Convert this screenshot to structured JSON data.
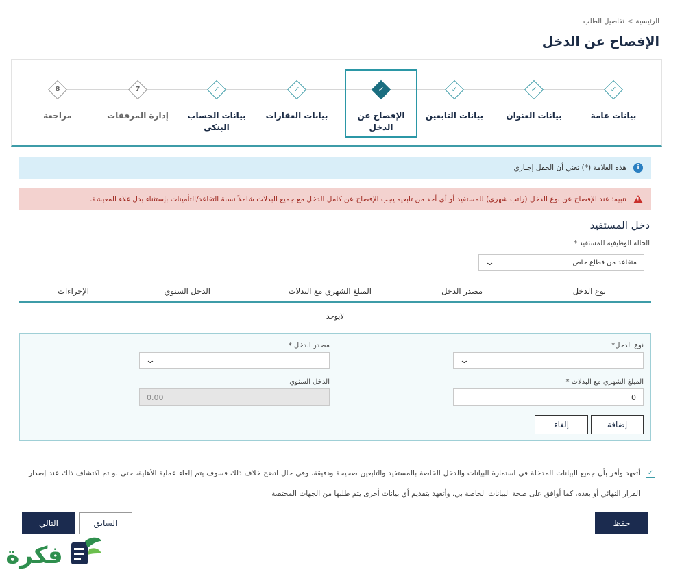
{
  "breadcrumb": {
    "home": "الرئيسية",
    "separator": ">",
    "current": "تفاصيل الطلب"
  },
  "page_title": "الإفصاح عن الدخل",
  "steps": [
    {
      "label": "بيانات عامة",
      "status": "done"
    },
    {
      "label": "بيانات العنوان",
      "status": "done"
    },
    {
      "label": "بيانات التابعين",
      "status": "done"
    },
    {
      "label": "الإفصاح عن الدخل",
      "status": "active"
    },
    {
      "label": "بيانات العقارات",
      "status": "done"
    },
    {
      "label": "بيانات الحساب البنكي",
      "status": "done"
    },
    {
      "label": "إدارة المرفقات",
      "status": "pending",
      "number": "7"
    },
    {
      "label": "مراجعة",
      "status": "pending",
      "number": "8"
    }
  ],
  "alerts": {
    "info": "هذه العلامة (*) تعني أن الحقل إجباري",
    "warning": "تنبيه: عند الإفصاح عن نوع الدخل (راتب شهري) للمستفيد أو أي أحد من تابعيه يجب الإفصاح عن كامل الدخل مع جميع البدلات شاملاً نسبة التقاعد/التأمينات بإستثناء بدل غلاء المعيشة."
  },
  "beneficiary_income": {
    "section_title": "دخل المستفيد",
    "employment_status_label": "الحالة الوظيفية للمستفيد *",
    "employment_status_value": "متقاعد من قطاع خاص"
  },
  "table": {
    "headers": [
      "نوع الدخل",
      "مصدر الدخل",
      "المبلغ الشهري مع البدلات",
      "الدخل السنوي",
      "الإجراءات"
    ],
    "empty_text": "لايوجد"
  },
  "form": {
    "income_type_label": "نوع الدخل*",
    "income_type_value": "",
    "income_source_label": "مصدر الدخل *",
    "income_source_value": "",
    "monthly_amount_label": "المبلغ الشهري مع البدلات *",
    "monthly_amount_value": "0",
    "annual_income_label": "الدخل السنوي",
    "annual_income_value": "0.00",
    "add_button": "إضافة",
    "cancel_button": "إلغاء"
  },
  "consent": {
    "checked": true,
    "text": "أتعهد وأقر بأن جميع البيانات المدخلة في استمارة البيانات والدخل الخاصة بالمستفيد والتابعين صحيحة ودقيقة، وفي حال اتضح خلاف ذلك فسوف يتم إلغاء عملية الأهلية، حتى لو تم اكتشاف ذلك عند إصدار القرار النهائي أو بعده، كما أوافق على صحة البيانات الخاصة بي، وأتعهد بتقديم أي بيانات أخرى يتم طلبها من الجهات المختصة"
  },
  "footer": {
    "save_button": "حفظ",
    "previous_button": "السابق",
    "next_button": "التالي"
  },
  "logo_text": "فكرة",
  "colors": {
    "accent": "#3d9ca8",
    "navy": "#1b2b4f",
    "info_bg": "#d9eef8",
    "warning_bg": "#f3d2cf",
    "logo_green": "#2f8f4e"
  }
}
